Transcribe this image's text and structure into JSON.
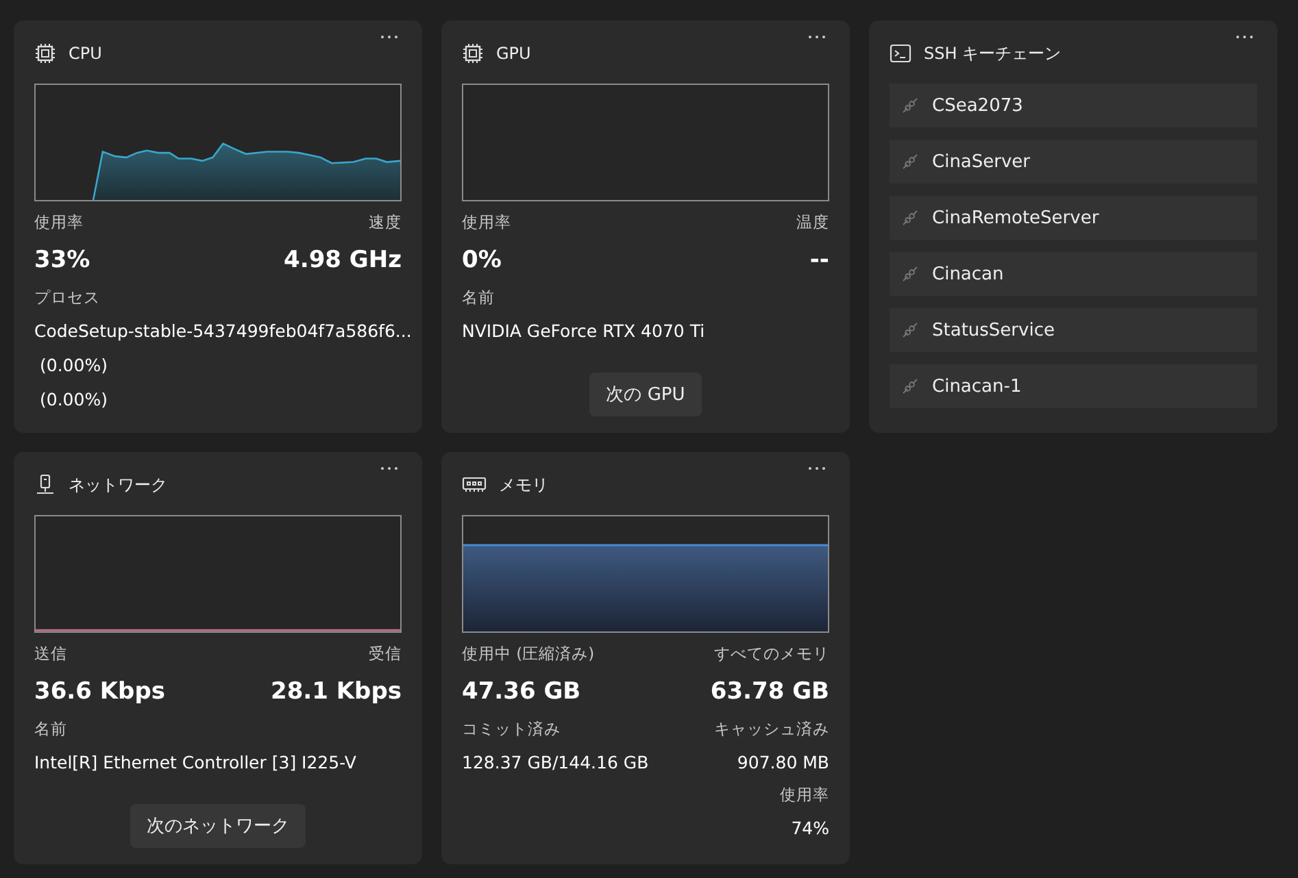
{
  "widgets": [
    {
      "kind": "cpu",
      "title": "CPU",
      "metrics": [
        {
          "label": "使用率",
          "value": "33%"
        },
        {
          "label": "速度",
          "value": "4.98 GHz"
        }
      ],
      "left_details": [
        {
          "label": "プロセス",
          "values": [
            "CodeSetup-stable-5437499feb04f7a586f6...",
            "(0.00%)",
            "(0.00%)"
          ]
        }
      ]
    },
    {
      "kind": "gpu",
      "title": "GPU",
      "metrics": [
        {
          "label": "使用率",
          "value": "0%"
        },
        {
          "label": "温度",
          "value": "--"
        }
      ],
      "left_details": [
        {
          "label": "名前",
          "values": [
            "NVIDIA GeForce RTX 4070 Ti"
          ]
        }
      ],
      "button": "次の GPU"
    },
    {
      "kind": "ssh",
      "title": "SSH キーチェーン",
      "items": [
        "CSea2073",
        "CinaServer",
        "CinaRemoteServer",
        "Cinacan",
        "StatusService",
        "Cinacan-1"
      ]
    },
    {
      "kind": "network",
      "title": "ネットワーク",
      "metrics": [
        {
          "label": "送信",
          "value": "36.6 Kbps"
        },
        {
          "label": "受信",
          "value": "28.1 Kbps"
        }
      ],
      "left_details": [
        {
          "label": "名前",
          "values": [
            "Intel[R] Ethernet Controller [3] I225-V"
          ]
        }
      ],
      "button": "次のネットワーク"
    },
    {
      "kind": "memory",
      "title": "メモリ",
      "metrics": [
        {
          "label": "使用中 (圧縮済み)",
          "value": "47.36 GB"
        },
        {
          "label": "すべてのメモリ",
          "value": "63.78 GB"
        }
      ],
      "left_details": [
        {
          "label": "コミット済み",
          "values": [
            "128.37 GB/144.16 GB"
          ]
        }
      ],
      "right_details": [
        {
          "label": "キャッシュ済み",
          "values": [
            "907.80 MB"
          ]
        },
        {
          "label": "使用率",
          "values": [
            "74%"
          ]
        }
      ]
    }
  ]
}
